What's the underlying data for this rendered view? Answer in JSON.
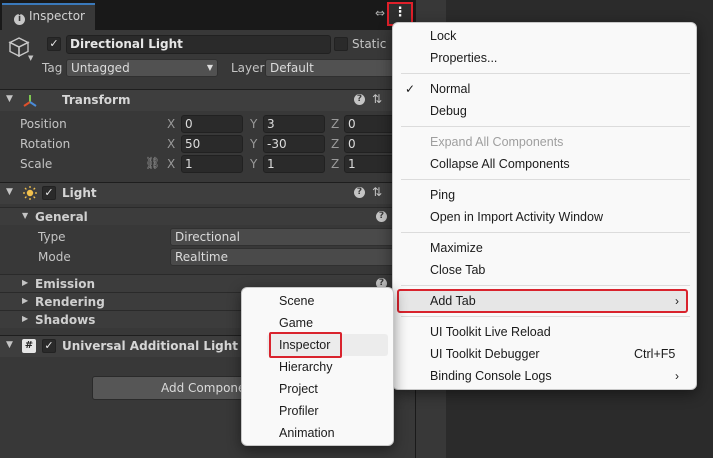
{
  "window": {
    "tab_title": "Inspector"
  },
  "header": {
    "object_name": "Directional Light",
    "active": true,
    "static_label": "Static",
    "tag_label": "Tag",
    "tag_value": "Untagged",
    "layer_label": "Layer",
    "layer_value": "Default"
  },
  "transform": {
    "title": "Transform",
    "rows": [
      {
        "label": "Position",
        "x": "0",
        "y": "3",
        "z": "0"
      },
      {
        "label": "Rotation",
        "x": "50",
        "y": "-30",
        "z": "0"
      },
      {
        "label": "Scale",
        "x": "1",
        "y": "1",
        "z": "1"
      }
    ],
    "axes": [
      "X",
      "Y",
      "Z"
    ]
  },
  "light": {
    "title": "Light",
    "enabled": true,
    "general": {
      "title": "General",
      "type_label": "Type",
      "type_value": "Directional",
      "mode_label": "Mode",
      "mode_value": "Realtime"
    },
    "emission": "Emission",
    "rendering": "Rendering",
    "shadows": "Shadows"
  },
  "extra_component": {
    "title": "Universal Additional Light Data",
    "enabled": true
  },
  "add_component_label": "Add Component",
  "context_menu": {
    "lock": "Lock",
    "properties": "Properties...",
    "normal": "Normal",
    "debug": "Debug",
    "expand_all": "Expand All Components",
    "collapse_all": "Collapse All Components",
    "ping": "Ping",
    "open_import": "Open in Import Activity Window",
    "maximize": "Maximize",
    "close_tab": "Close Tab",
    "add_tab": "Add Tab",
    "ui_live_reload": "UI Toolkit Live Reload",
    "ui_debugger": "UI Toolkit Debugger",
    "ui_debugger_shortcut": "Ctrl+F5",
    "binding_logs": "Binding Console Logs"
  },
  "add_tab_submenu": [
    "Scene",
    "Game",
    "Inspector",
    "Hierarchy",
    "Project",
    "Profiler",
    "Animation"
  ],
  "colors": {
    "highlight_border": "#d9232d",
    "accent_tab": "#3a79bb"
  }
}
